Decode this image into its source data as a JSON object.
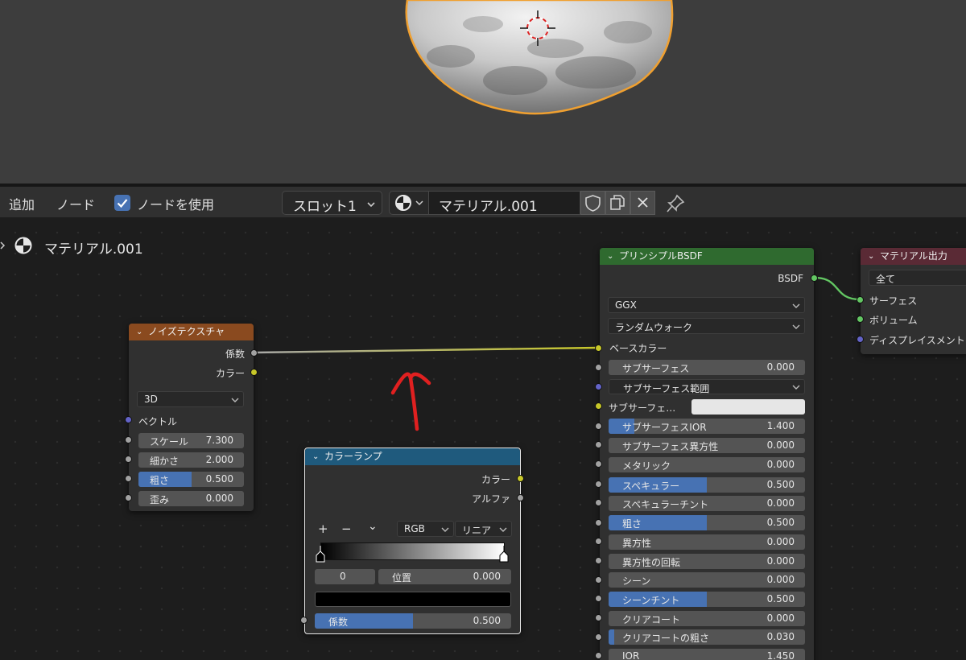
{
  "header": {
    "menu_add": "追加",
    "menu_node": "ノード",
    "use_nodes_label": "ノードを使用",
    "slot": "スロット1",
    "material_name": "マテリアル.001"
  },
  "breadcrumb": {
    "material": "マテリアル.001"
  },
  "noise_texture": {
    "title": "ノイズテクスチャ",
    "out_fac": "係数",
    "out_color": "カラー",
    "dimensions": "3D",
    "vector": "ベクトル",
    "fields": [
      {
        "label": "スケール",
        "value": "7.300",
        "fill": 0
      },
      {
        "label": "細かさ",
        "value": "2.000",
        "fill": 0
      },
      {
        "label": "粗さ",
        "value": "0.500",
        "fill": 0.5
      },
      {
        "label": "歪み",
        "value": "0.000",
        "fill": 0
      }
    ]
  },
  "color_ramp": {
    "title": "カラーランプ",
    "out_color": "カラー",
    "out_alpha": "アルファ",
    "add": "+",
    "remove": "−",
    "menu": "⌄",
    "mode": "RGB",
    "interpolation": "リニア",
    "stop_index": "0",
    "position_label": "位置",
    "position_value": "0.000",
    "fac_label": "係数",
    "fac_value": "0.500",
    "fac_fill": 0.5
  },
  "principled": {
    "title": "プリンシプルBSDF",
    "out": "BSDF",
    "distribution": "GGX",
    "subsurface_method": "ランダムウォーク",
    "base_color": "ベースカラー",
    "subsurface_color": "サブサーフェ…",
    "fields": [
      {
        "label": "サブサーフェス",
        "value": "0.000",
        "fill": 0
      },
      {
        "label": "サブサーフェス範囲",
        "value": "",
        "fill": 0
      },
      {
        "label": "サブサーフェス色",
        "value": "",
        "fill": 0
      },
      {
        "label": "サブサーフェスIOR",
        "value": "1.400",
        "fill": 0.13
      },
      {
        "label": "サブサーフェス異方性",
        "value": "0.000",
        "fill": 0
      },
      {
        "label": "メタリック",
        "value": "0.000",
        "fill": 0
      },
      {
        "label": "スペキュラー",
        "value": "0.500",
        "fill": 0.5
      },
      {
        "label": "スペキュラーチント",
        "value": "0.000",
        "fill": 0
      },
      {
        "label": "粗さ",
        "value": "0.500",
        "fill": 0.5
      },
      {
        "label": "異方性",
        "value": "0.000",
        "fill": 0
      },
      {
        "label": "異方性の回転",
        "value": "0.000",
        "fill": 0
      },
      {
        "label": "シーン",
        "value": "0.000",
        "fill": 0
      },
      {
        "label": "シーンチント",
        "value": "0.500",
        "fill": 0.5
      },
      {
        "label": "クリアコート",
        "value": "0.000",
        "fill": 0
      },
      {
        "label": "クリアコートの粗さ",
        "value": "0.030",
        "fill": 0.03
      },
      {
        "label": "IOR",
        "value": "1.450",
        "fill": 0
      }
    ]
  },
  "material_output": {
    "title": "マテリアル出力",
    "target": "全て",
    "surface": "サーフェス",
    "volume": "ボリューム",
    "displacement": "ディスプレイスメント"
  },
  "colors": {
    "noise_header": "#8a4a1f",
    "ramp_header": "#1f5a7d",
    "bsdf_header": "#2f6a2f",
    "output_header": "#5a2a35",
    "selection_outline": "#f0a030",
    "annotation_arrow": "#e02020"
  }
}
